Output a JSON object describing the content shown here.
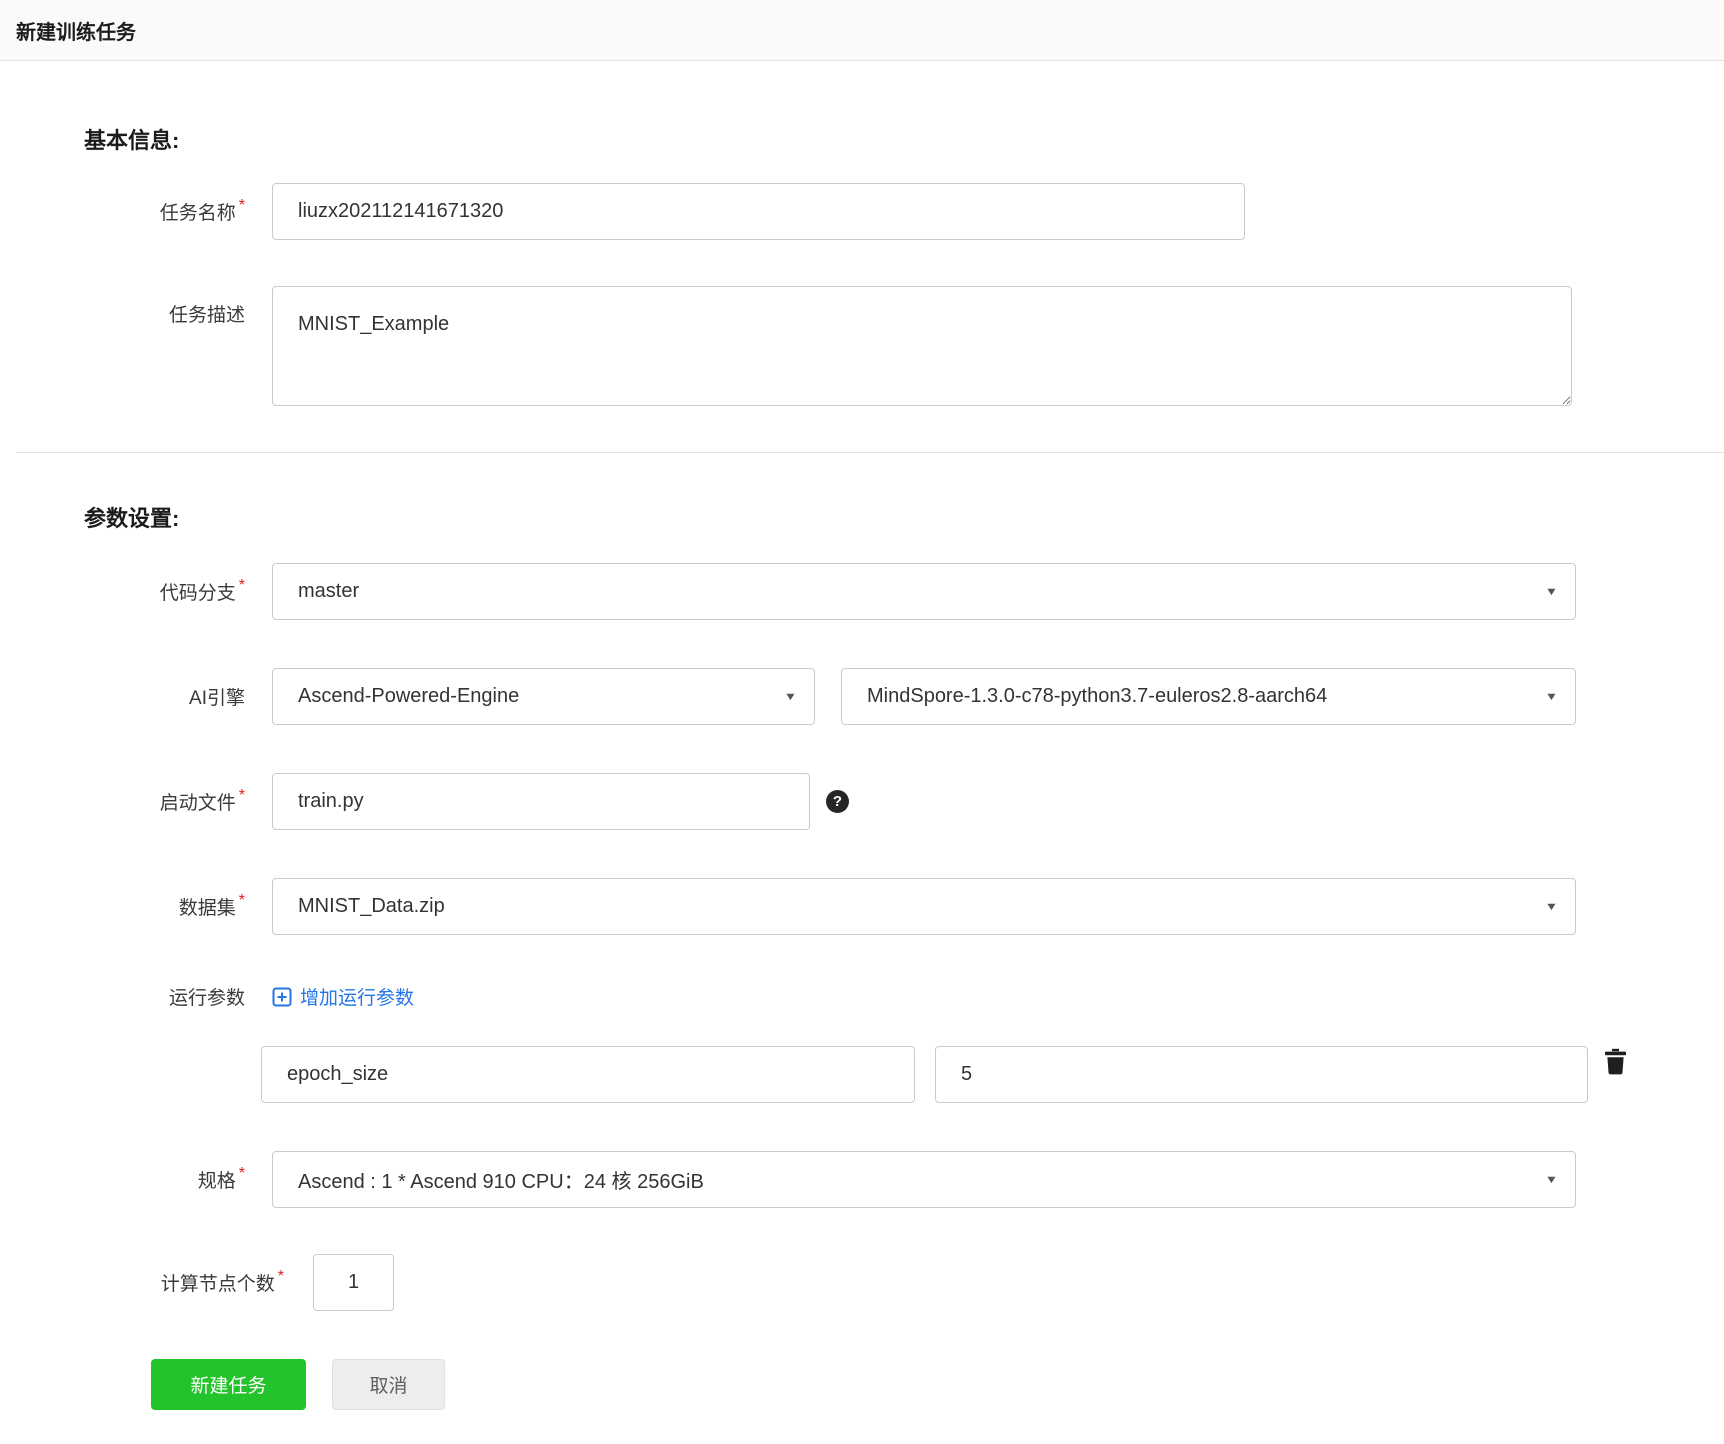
{
  "page": {
    "title": "新建训练任务"
  },
  "colors": {
    "accent_blue": "#2575e6",
    "primary_green": "#23c32b",
    "required_red": "#e02020",
    "header_bg": "#fafafa",
    "input_border": "#cbcbcb"
  },
  "icons": {
    "caret": "▼",
    "help": "?",
    "required": "*",
    "add": "plus-square-icon",
    "delete": "trash-icon"
  },
  "sections": {
    "basic": {
      "heading": "基本信息:"
    },
    "params": {
      "heading": "参数设置:"
    }
  },
  "fields": {
    "task_name": {
      "label": "任务名称",
      "value": "liuzx202112141671320"
    },
    "task_desc": {
      "label": "任务描述",
      "value": "MNIST_Example"
    },
    "code_branch": {
      "label": "代码分支",
      "value": "master"
    },
    "ai_engine": {
      "label": "AI引擎",
      "engine_value": "Ascend-Powered-Engine",
      "version_value": "MindSpore-1.3.0-c78-python3.7-euleros2.8-aarch64"
    },
    "boot_file": {
      "label": "启动文件",
      "value": "train.py"
    },
    "dataset": {
      "label": "数据集",
      "value": "MNIST_Data.zip"
    },
    "run_params": {
      "label": "运行参数",
      "add_link": "增加运行参数",
      "rows": [
        {
          "key": "epoch_size",
          "value": "5"
        }
      ]
    },
    "spec": {
      "label": "规格",
      "value": "Ascend : 1 * Ascend 910 CPU：24 核 256GiB"
    },
    "node_count": {
      "label": "计算节点个数",
      "value": "1"
    }
  },
  "buttons": {
    "submit": "新建任务",
    "cancel": "取消"
  }
}
